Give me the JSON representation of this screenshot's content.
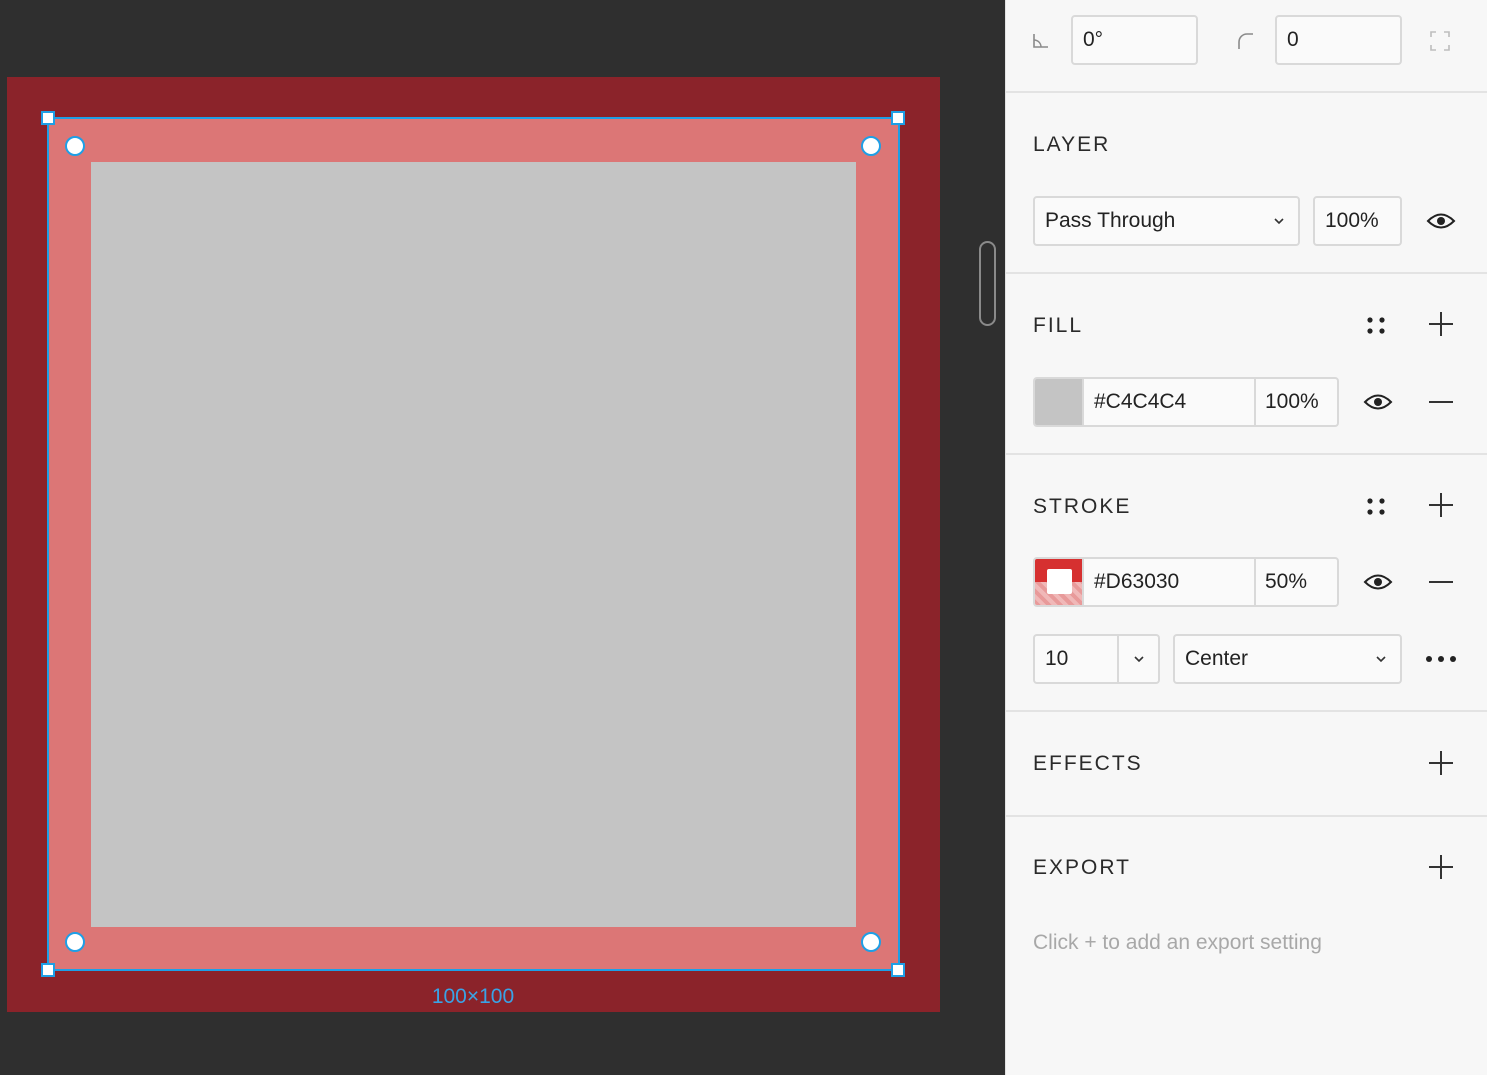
{
  "canvas": {
    "frame_color": "#8b232a",
    "stroke_color": "#dc7676",
    "fill_color": "#c4c4c4",
    "selection_color": "#1e9fe6",
    "size_label": "100×100"
  },
  "panel": {
    "rotation": {
      "value": "0°",
      "icon": "rotation-angle-icon"
    },
    "corner": {
      "value": "0",
      "icon": "corner-radius-icon"
    },
    "independent_corners_icon": "independent-corners-icon",
    "layer": {
      "title": "LAYER",
      "blend_mode": "Pass Through",
      "opacity": "100%"
    },
    "fill": {
      "title": "FILL",
      "hex": "#C4C4C4",
      "opacity": "100%",
      "swatch": "#c4c4c4"
    },
    "stroke": {
      "title": "STROKE",
      "hex": "#D63030",
      "opacity": "50%",
      "swatch": "#d63030",
      "weight": "10",
      "align": "Center"
    },
    "effects": {
      "title": "EFFECTS"
    },
    "export": {
      "title": "EXPORT",
      "hint": "Click + to add an export setting"
    }
  }
}
